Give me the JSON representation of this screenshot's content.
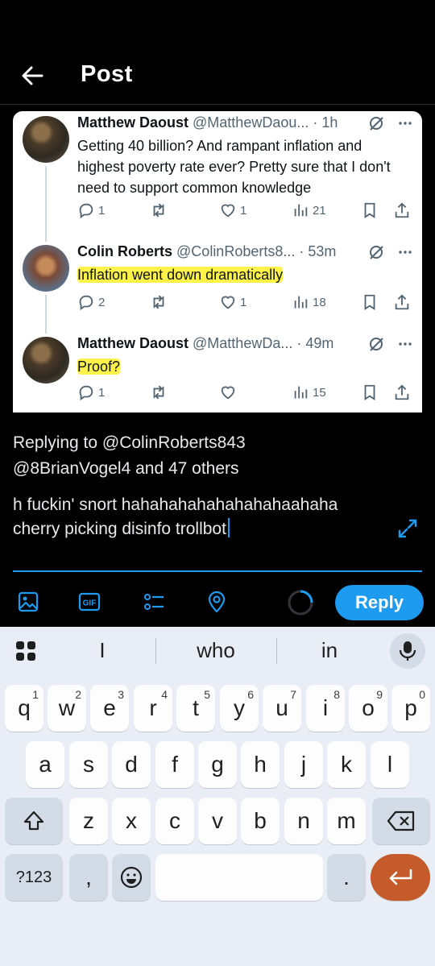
{
  "header": {
    "title": "Post"
  },
  "tweets": [
    {
      "name": "Matthew Daoust",
      "handle": "@MatthewDaou...",
      "time": "· 1h",
      "text": "Getting 40 billion? And rampant inflation and highest poverty rate ever? Pretty sure that I don't need to support common knowledge",
      "replies": "1",
      "retweets": "",
      "likes": "1",
      "views": "21"
    },
    {
      "name": "Colin Roberts",
      "handle": "@ColinRoberts8...",
      "time": "· 53m",
      "text": "Inflation went down dramatically",
      "replies": "2",
      "retweets": "",
      "likes": "1",
      "views": "18"
    },
    {
      "name": "Matthew Daoust",
      "handle": "@MatthewDa...",
      "time": "· 49m",
      "text": "Proof?",
      "replies": "1",
      "retweets": "",
      "likes": "",
      "views": "15"
    }
  ],
  "compose": {
    "replying_line1": "Replying to @ColinRoberts843",
    "replying_line2": "@8BrianVogel4 and 47 others",
    "text": "h fuckin' snort hahahahahahahahahaahaha cherry picking disinfo trollbot",
    "reply_button": "Reply"
  },
  "keyboard": {
    "suggestions": [
      "I",
      "who",
      "in"
    ],
    "row1": [
      {
        "k": "q",
        "s": "1"
      },
      {
        "k": "w",
        "s": "2"
      },
      {
        "k": "e",
        "s": "3"
      },
      {
        "k": "r",
        "s": "4"
      },
      {
        "k": "t",
        "s": "5"
      },
      {
        "k": "y",
        "s": "6"
      },
      {
        "k": "u",
        "s": "7"
      },
      {
        "k": "i",
        "s": "8"
      },
      {
        "k": "o",
        "s": "9"
      },
      {
        "k": "p",
        "s": "0"
      }
    ],
    "row2": [
      "a",
      "s",
      "d",
      "f",
      "g",
      "h",
      "j",
      "k",
      "l"
    ],
    "row3": [
      "z",
      "x",
      "c",
      "v",
      "b",
      "n",
      "m"
    ],
    "symbols_key": "?123",
    "comma_key": ",",
    "period_key": "."
  },
  "colors": {
    "accent": "#1d9bf0",
    "highlight": "#fff34a",
    "enter_key": "#c55a2a"
  }
}
